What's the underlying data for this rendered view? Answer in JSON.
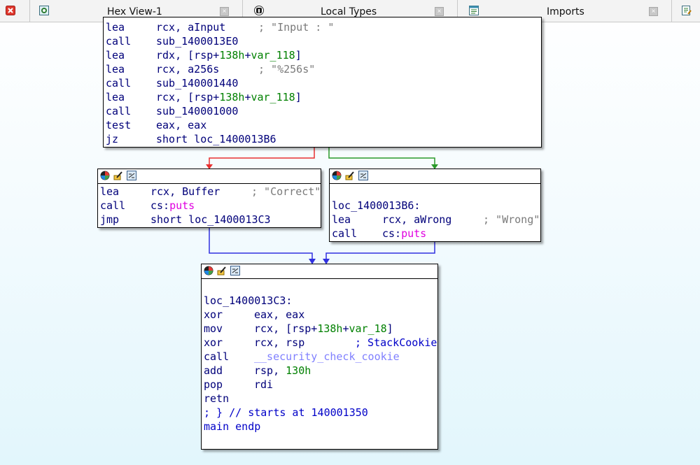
{
  "tabs": [
    {
      "label": "",
      "icon": "close-red-icon"
    },
    {
      "label": "Hex View-1",
      "icon": "hex-view-icon"
    },
    {
      "label": "Local Types",
      "icon": "local-types-icon"
    },
    {
      "label": "Imports",
      "icon": "imports-icon"
    }
  ],
  "tab_close_glyph": "×",
  "node_top": {
    "lines": [
      {
        "mn": "lea",
        "op": "rcx, aInput",
        "cm": "; \"Input : \""
      },
      {
        "mn": "call",
        "op": "sub_1400013E0"
      },
      {
        "mn": "lea",
        "op_parts": [
          "rdx, [rsp+",
          "138h",
          "+",
          "var_118",
          "]"
        ]
      },
      {
        "mn": "lea",
        "op": "rcx, a256s",
        "cm": "; \"%256s\""
      },
      {
        "mn": "call",
        "op": "sub_140001440"
      },
      {
        "mn": "lea",
        "op_parts": [
          "rcx, [rsp+",
          "138h",
          "+",
          "var_118",
          "]"
        ]
      },
      {
        "mn": "call",
        "op": "sub_140001000"
      },
      {
        "mn": "test",
        "op": "eax, eax"
      },
      {
        "mn": "jz",
        "op": "short loc_1400013B6"
      }
    ]
  },
  "node_left": {
    "lines": [
      {
        "mn": "lea",
        "op": "rcx, Buffer",
        "cm": "; \"Correct\""
      },
      {
        "mn": "call",
        "op_a": "cs:",
        "op_b": "puts"
      },
      {
        "mn": "jmp",
        "op": "short loc_1400013C3"
      }
    ]
  },
  "node_right": {
    "label": "loc_1400013B6:",
    "lines": [
      {
        "mn": "lea",
        "op": "rcx, aWrong",
        "cm": "; \"Wrong\""
      },
      {
        "mn": "call",
        "op_a": "cs:",
        "op_b": "puts"
      }
    ]
  },
  "node_bottom": {
    "label": "loc_1400013C3:",
    "lines": [
      {
        "mn": "xor",
        "op": "eax, eax"
      },
      {
        "mn": "mov",
        "op_parts": [
          "rcx, [rsp+",
          "138h",
          "+",
          "var_18",
          "]"
        ]
      },
      {
        "mn": "xor",
        "op": "rcx, rsp",
        "cm": "; StackCookie"
      },
      {
        "mn": "call",
        "op": "__security_check_cookie"
      },
      {
        "mn": "add",
        "op_a": "rsp, ",
        "op_b": "130h"
      },
      {
        "mn": "pop",
        "op": "rdi"
      },
      {
        "mn": "retn",
        "op": ""
      }
    ],
    "footer1": "; } // starts at 140001350",
    "footer2": "main endp"
  },
  "edge_colors": {
    "false_branch": "#e83030",
    "true_branch": "#2a9a2a",
    "unconditional": "#3030e0"
  }
}
